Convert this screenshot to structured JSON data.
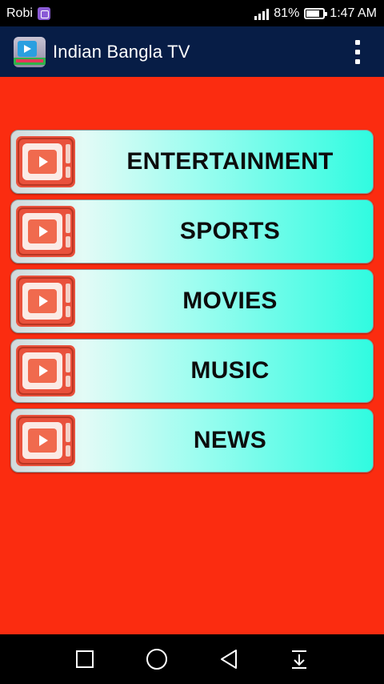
{
  "status_bar": {
    "carrier": "Robi",
    "battery_percent": "81%",
    "time": "1:47 AM",
    "battery_level": 0.81,
    "icons": [
      "sim-icon",
      "signal-icon",
      "battery-icon"
    ]
  },
  "app_bar": {
    "title": "Indian Bangla TV",
    "background_color": "#071d46",
    "logo_icon": "tv-logo-icon",
    "menu_icon": "overflow-menu-icon"
  },
  "main": {
    "background_color": "#fb2c10",
    "categories": [
      {
        "label": "ENTERTAINMENT",
        "icon": "tv-play-icon"
      },
      {
        "label": "SPORTS",
        "icon": "tv-play-icon"
      },
      {
        "label": "MOVIES",
        "icon": "tv-play-icon"
      },
      {
        "label": "MUSIC",
        "icon": "tv-play-icon"
      },
      {
        "label": "NEWS",
        "icon": "tv-play-icon"
      }
    ]
  },
  "nav_bar": {
    "buttons": [
      "recents-square-icon",
      "home-circle-icon",
      "back-triangle-icon",
      "notification-pull-icon"
    ]
  }
}
